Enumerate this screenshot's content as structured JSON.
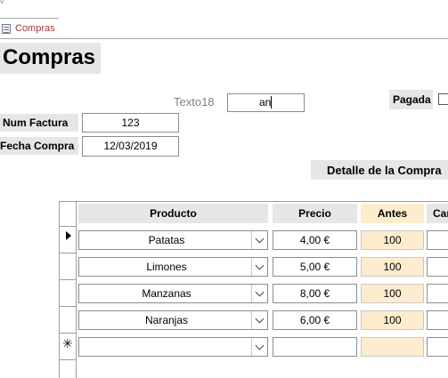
{
  "tab": {
    "label": "Compras",
    "icon": "form-icon"
  },
  "form": {
    "title": "Compras",
    "texto18": {
      "label": "Texto18",
      "value": "an"
    },
    "pagada": {
      "label": "Pagada",
      "checked": false
    },
    "num_factura": {
      "label": "Num Factura",
      "value": "123"
    },
    "fecha_compra": {
      "label": "Fecha Compra",
      "value": "12/03/2019"
    },
    "detalle_label": "Detalle de la Compra"
  },
  "subform": {
    "columns": [
      "Producto",
      "Precio",
      "Antes",
      "Can"
    ],
    "rows": [
      {
        "producto": "Patatas",
        "precio": "4,00 €",
        "antes": "100",
        "cantidad": ""
      },
      {
        "producto": "Limones",
        "precio": "5,00 €",
        "antes": "100",
        "cantidad": ""
      },
      {
        "producto": "Manzanas",
        "precio": "8,00 €",
        "antes": "100",
        "cantidad": ""
      },
      {
        "producto": "Naranjas",
        "precio": "6,00 €",
        "antes": "100",
        "cantidad": ""
      },
      {
        "producto": "",
        "precio": "",
        "antes": "",
        "cantidad": ""
      }
    ],
    "current_row_marker": "▶",
    "new_row_marker": "✳"
  },
  "colors": {
    "label_bg": "#e6e6e6",
    "antes_bg": "#fdeccd",
    "tab_text": "#a4373a"
  }
}
